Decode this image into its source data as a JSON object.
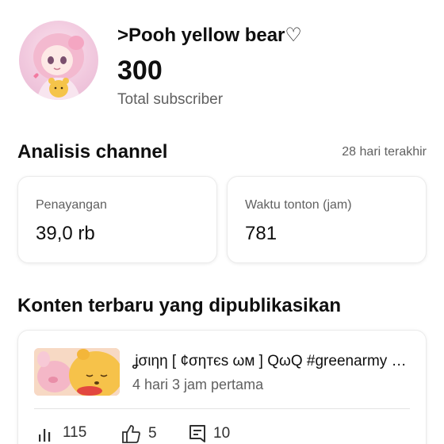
{
  "channel": {
    "name": ">Pooh yellow bear♡",
    "subscriber_count": "300",
    "subscriber_label": "Total subscriber"
  },
  "analytics": {
    "title": "Analisis channel",
    "period": "28 hari terakhir",
    "metrics": [
      {
        "label": "Penayangan",
        "value": "39,0 rb"
      },
      {
        "label": "Waktu tonton (jam)",
        "value": "781"
      }
    ]
  },
  "latest": {
    "title": "Konten terbaru yang dipublikasikan",
    "video": {
      "title": "ʝσιηη [ ¢σηтєѕ ωм ] QωQ #greenarmy #wontbefreedomgreenarmy",
      "subtitle": "4 hari 3 jam pertama",
      "stats": {
        "views": "115",
        "likes": "5",
        "comments": "10"
      }
    }
  },
  "icons": {
    "avatar": "anime-avatar-icon",
    "thumbnail": "video-thumbnail",
    "views": "bar-chart-icon",
    "likes": "thumbs-up-icon",
    "comments": "comment-icon"
  },
  "colors": {
    "text": "#0f0f0f",
    "secondary": "#606060",
    "card_border": "#ebebeb"
  }
}
